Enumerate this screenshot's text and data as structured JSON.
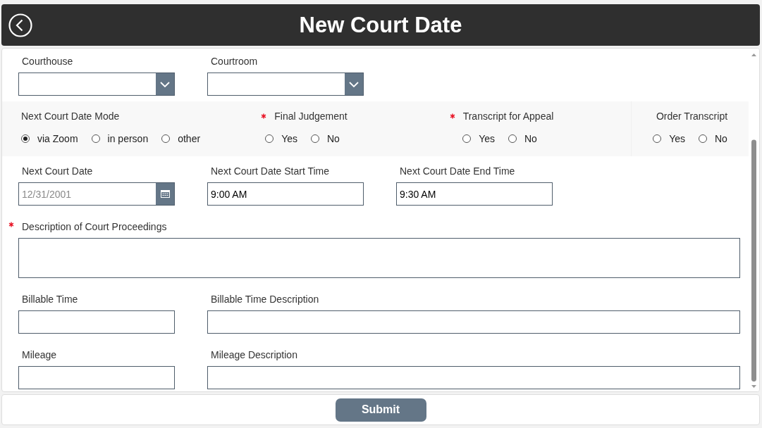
{
  "header": {
    "title": "New Court Date"
  },
  "dropdowns": [
    {
      "label": "Courthouse"
    },
    {
      "label": "Courtroom"
    }
  ],
  "radio_groups": [
    {
      "label": "Next Court Date Mode",
      "required": false,
      "options": [
        {
          "label": "via Zoom",
          "selected": true
        },
        {
          "label": "in person",
          "selected": false
        },
        {
          "label": "other",
          "selected": false
        }
      ]
    },
    {
      "label": "Final Judgement",
      "required": true,
      "options": [
        {
          "label": "Yes",
          "selected": false
        },
        {
          "label": "No",
          "selected": false
        }
      ]
    },
    {
      "label": "Transcript for Appeal",
      "required": true,
      "options": [
        {
          "label": "Yes",
          "selected": false
        },
        {
          "label": "No",
          "selected": false
        }
      ]
    },
    {
      "label": "Order Transcript",
      "required": false,
      "options": [
        {
          "label": "Yes",
          "selected": false
        },
        {
          "label": "No",
          "selected": false
        }
      ]
    }
  ],
  "date_time_fields": [
    {
      "kind": "date",
      "label": "Next Court Date",
      "placeholder": "12/31/2001"
    },
    {
      "kind": "time",
      "label": "Next Court Date Start Time",
      "value": "9:00 AM"
    },
    {
      "kind": "time",
      "label": "Next Court Date End Time",
      "value": "9:30 AM"
    }
  ],
  "description": {
    "label": "Description of Court Proceedings",
    "required": true
  },
  "text_fields": [
    {
      "label": "Billable Time",
      "wide": false
    },
    {
      "label": "Billable Time Description",
      "wide": true
    },
    {
      "label": "Mileage",
      "wide": false
    },
    {
      "label": "Mileage Description",
      "wide": true
    }
  ],
  "submit_button": "Submit"
}
